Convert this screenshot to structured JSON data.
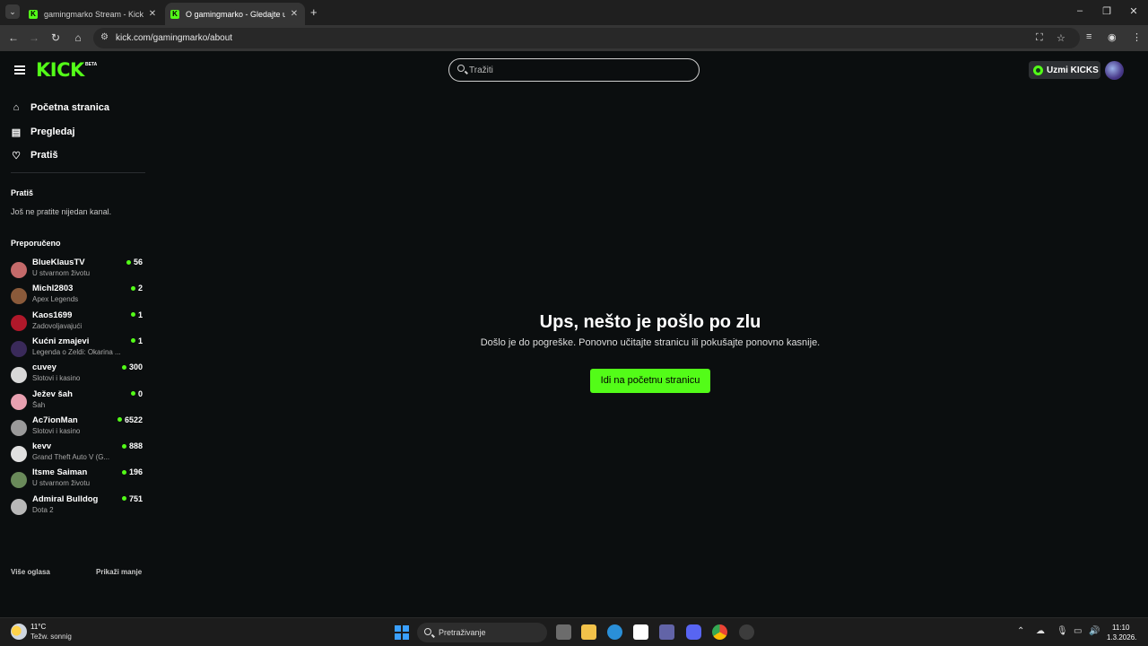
{
  "browser": {
    "tabs": [
      {
        "title": "gamingmarko Stream - Kick Da",
        "active": false
      },
      {
        "title": "O gamingmarko - Gledajte uživ",
        "active": true
      }
    ],
    "url": "kick.com/gamingmarko/about",
    "icons": {
      "tab_list": "chevron-down-icon",
      "new_tab": "+",
      "close": "×"
    }
  },
  "header": {
    "logo": "KICK",
    "logo_badge": "BETA",
    "search_placeholder": "Tražiti",
    "kicks_button": "Uzmi KICKS"
  },
  "sidebar": {
    "nav": [
      {
        "label": "Početna stranica",
        "icon": "home-icon"
      },
      {
        "label": "Pregledaj",
        "icon": "browse-icon"
      },
      {
        "label": "Pratiš",
        "icon": "heart-icon"
      }
    ],
    "following_title": "Pratiš",
    "following_empty": "Još ne pratite nijedan kanal.",
    "recommended_title": "Preporučeno",
    "recommended": [
      {
        "name": "BlueKlausTV",
        "category": "U stvarnom životu",
        "viewers": "56",
        "color": "#c46a6a"
      },
      {
        "name": "Michl2803",
        "category": "Apex Legends",
        "viewers": "2",
        "color": "#8a5a3a"
      },
      {
        "name": "Kaos1699",
        "category": "Zadovoljavajući",
        "viewers": "1",
        "color": "#b0182a"
      },
      {
        "name": "Kućni zmajevi",
        "category": "Legenda o Zeldi: Okarina ...",
        "viewers": "1",
        "color": "#3a2a5a"
      },
      {
        "name": "cuvey",
        "category": "Slotovi i kasino",
        "viewers": "300",
        "color": "#d8d8d8"
      },
      {
        "name": "Ježev šah",
        "category": "Šah",
        "viewers": "0",
        "color": "#e8a0b0"
      },
      {
        "name": "Ac7ionMan",
        "category": "Slotovi i kasino",
        "viewers": "6522",
        "color": "#9a9a9a"
      },
      {
        "name": "kevv",
        "category": "Grand Theft Auto V (G...",
        "viewers": "888",
        "color": "#e0e0e0"
      },
      {
        "name": "Itsme Saiman",
        "category": "U stvarnom životu",
        "viewers": "196",
        "color": "#6a8a5a"
      },
      {
        "name": "Admiral Bulldog",
        "category": "Dota 2",
        "viewers": "751",
        "color": "#b8b8b8"
      }
    ],
    "show_more_ads": "Više oglasa",
    "show_less": "Prikaži manje"
  },
  "error": {
    "title": "Ups, nešto je pošlo po zlu",
    "message": "Došlo je do pogreške. Ponovno učitajte stranicu ili pokušajte ponovno kasnije.",
    "button": "Idi na početnu stranicu"
  },
  "taskbar": {
    "weather_temp": "11°C",
    "weather_desc": "Težw. sonnig",
    "search_label": "Pretraživanje",
    "time": "11:10",
    "date": "1.3.2026."
  },
  "colors": {
    "accent": "#53fc18",
    "background": "#0b0e0f"
  }
}
